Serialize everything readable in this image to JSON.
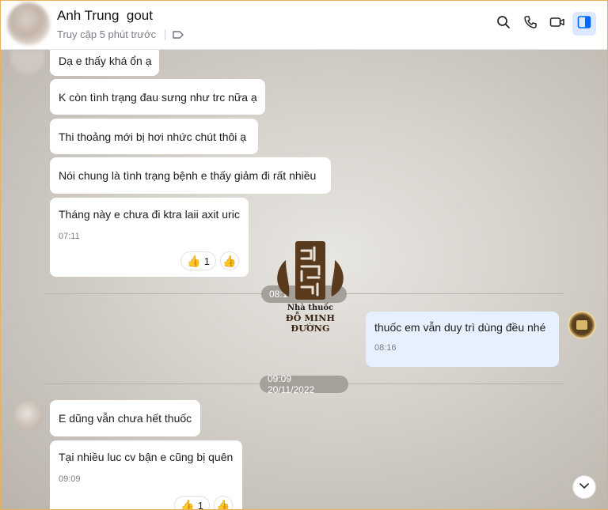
{
  "header": {
    "name": "Anh Trung  gout",
    "status": "Truy cập 5 phút trước"
  },
  "messages": {
    "m1": "Dạ e thấy khá ổn ạ",
    "m2": "K còn tình trạng đau sưng như trc nữa ạ",
    "m3": "Thi thoảng mới bị hơi nhức chút thôi ạ",
    "m4": "Nói chung là tình trạng bệnh e thấy giảm đi rất nhiều",
    "m5": "Tháng này e chưa đi ktra laii axit uric",
    "m5_time": "07:11",
    "m5_reaction_count": "1",
    "divider1_time": "08:1",
    "reply": "thuốc em vẫn duy trì dùng đều nhé",
    "reply_time": "08:16",
    "divider2_time": "09:09 20/11/2022",
    "m6": "E dũng vẫn chưa hết thuốc",
    "m7": "Tại nhiều luc cv bận e cũng bị quên",
    "m7_time": "09:09",
    "m7_reaction_count": "1"
  },
  "watermark": {
    "line1": "Nhà thuốc",
    "line2": "ĐỖ MINH ĐƯỜNG",
    "logo_text": "đỗ minh"
  },
  "colors": {
    "accent": "#0068ff",
    "active_btn_bg": "#dbe8ff",
    "reply_bubble": "#e6f0fe",
    "brand_brown": "#5a3a1c"
  },
  "icons": {
    "search": "search-icon",
    "call": "phone-icon",
    "video": "video-icon",
    "panel": "sidebar-panel-icon",
    "tag": "tag-icon",
    "thumbs_up": "thumbs-up-icon",
    "scroll_down": "chevron-down-icon"
  }
}
